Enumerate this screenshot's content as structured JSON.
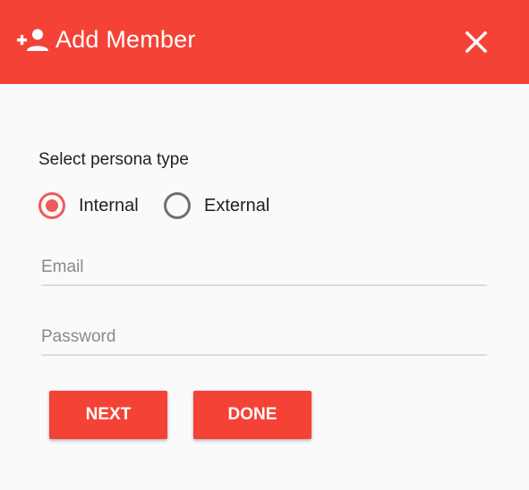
{
  "dialog": {
    "title": "Add Member",
    "header_icon": "person-add-icon",
    "close_icon": "close-icon",
    "accent_color": "#f44336"
  },
  "persona": {
    "label": "Select persona type",
    "options": [
      {
        "label": "Internal",
        "selected": true
      },
      {
        "label": "External",
        "selected": false
      }
    ]
  },
  "form": {
    "email_placeholder": "Email",
    "email_value": "",
    "password_placeholder": "Password",
    "password_value": ""
  },
  "actions": {
    "next_label": "NEXT",
    "done_label": "DONE"
  }
}
